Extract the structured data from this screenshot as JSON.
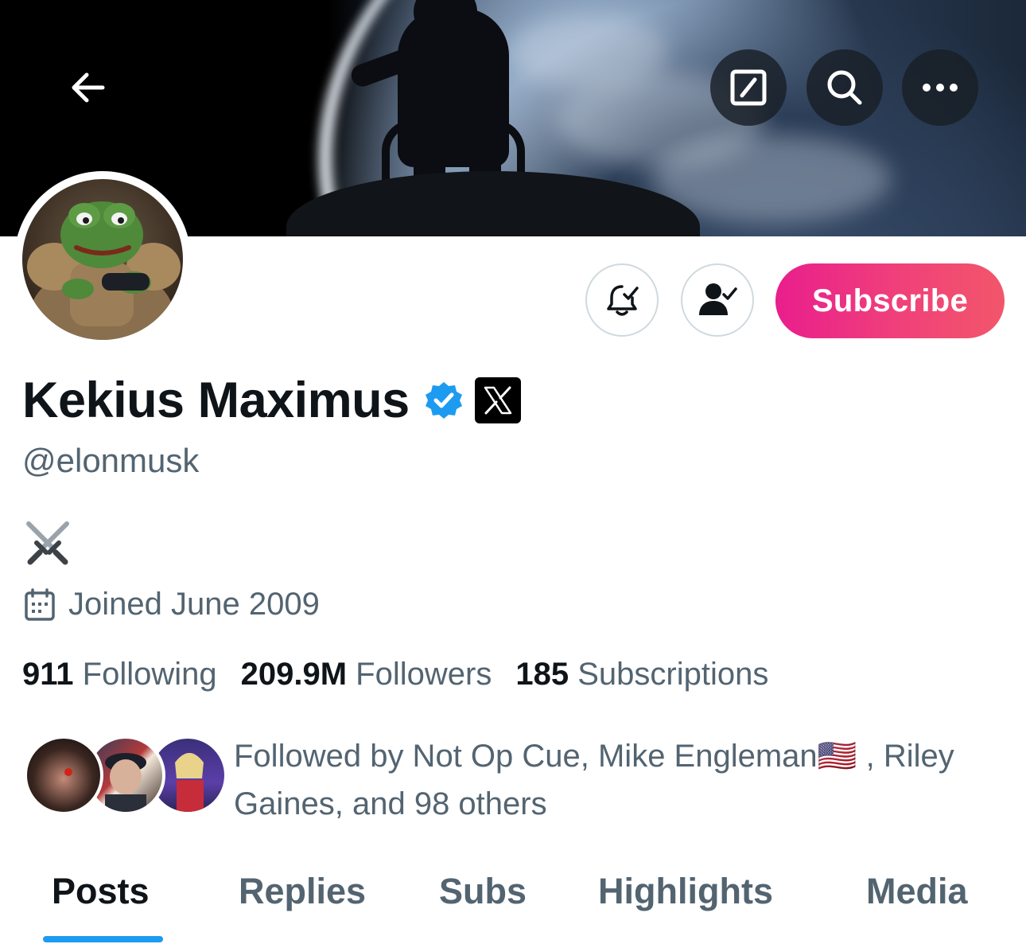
{
  "profile": {
    "name": "Kekius Maximus",
    "handle": "@elonmusk",
    "bio": "⚔️",
    "joined": "Joined June 2009"
  },
  "actions": {
    "subscribe_label": "Subscribe"
  },
  "stats": [
    {
      "value": "911",
      "label": "Following"
    },
    {
      "value": "209.9M",
      "label": "Followers"
    },
    {
      "value": "185",
      "label": "Subscriptions"
    }
  ],
  "followed_by": "Followed by Not Op Cue, Mike Engleman🇺🇸 , Riley Gaines, and 98 others",
  "tabs": [
    "Posts",
    "Replies",
    "Subs",
    "Highlights",
    "Media"
  ],
  "icons": {
    "back": "arrow-left-icon",
    "compose": "compose-icon",
    "search": "search-icon",
    "more": "more-icon",
    "notify": "bell-check-icon",
    "following": "person-check-icon",
    "verified": "verified-badge-icon",
    "x_logo": "x-logo-icon",
    "calendar": "calendar-icon"
  },
  "colors": {
    "accent": "#1d9bf0",
    "subscribe_start": "#e91e8c",
    "subscribe_end": "#f2566a",
    "text_primary": "#0f1419",
    "text_secondary": "#536471"
  }
}
